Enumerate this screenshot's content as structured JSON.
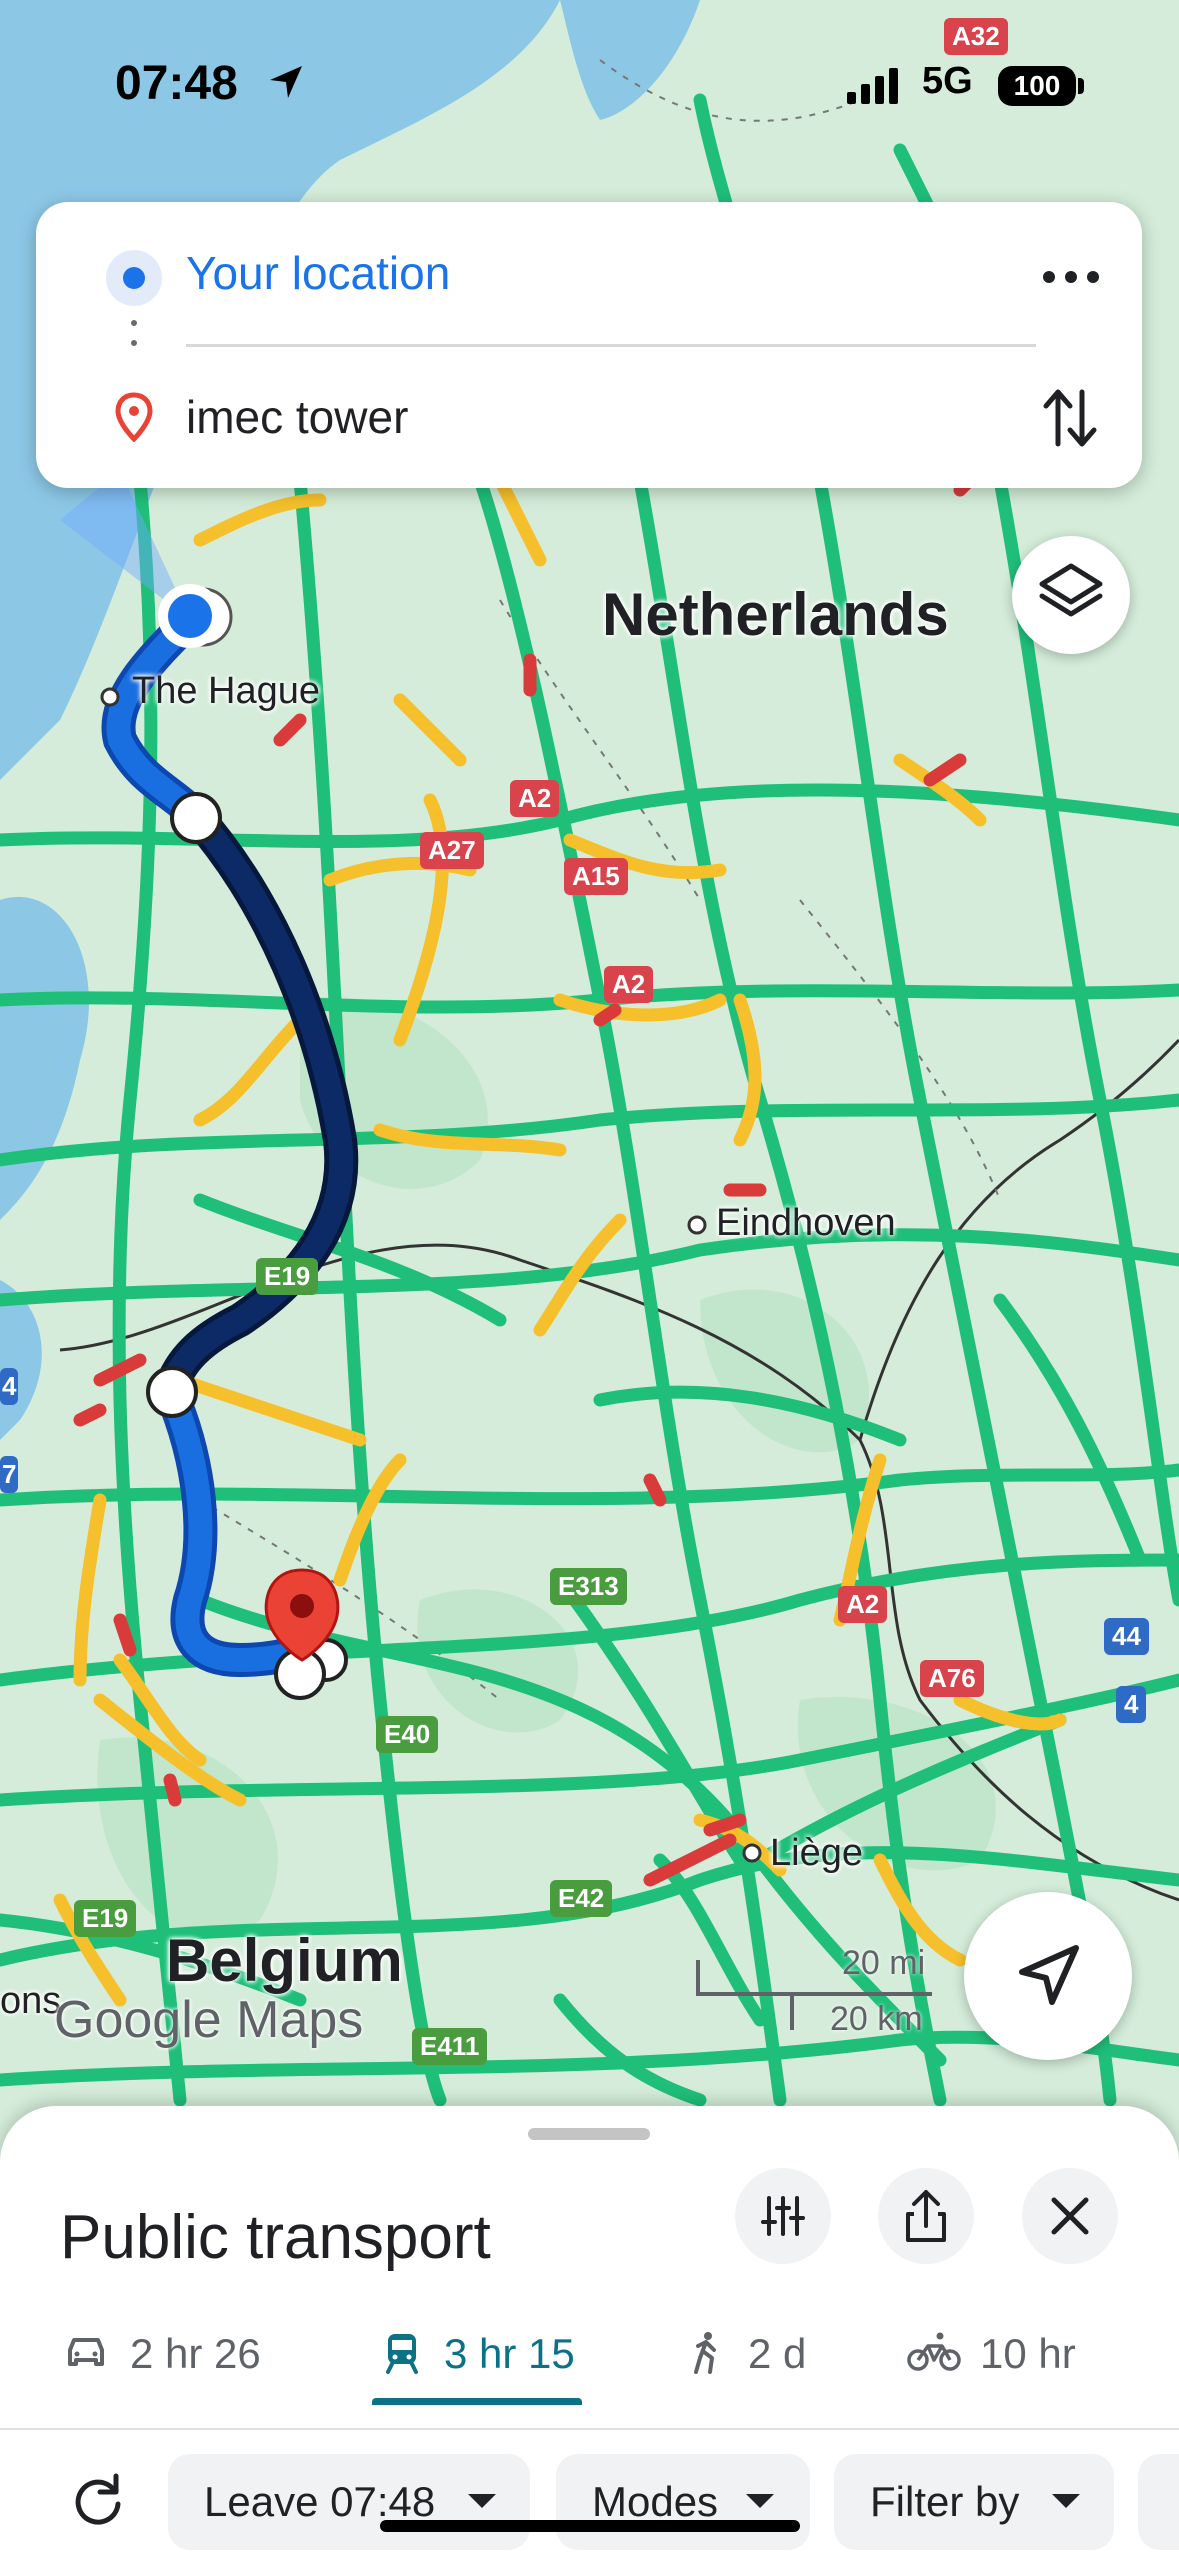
{
  "status_bar": {
    "time": "07:48",
    "network": "5G",
    "battery": "100"
  },
  "search": {
    "origin": "Your location",
    "destination": "imec tower"
  },
  "map_labels": {
    "countries": [
      "Netherlands",
      "Belgium"
    ],
    "cities": [
      "The Hague",
      "Eindhoven",
      "Liège",
      "ons"
    ],
    "road_shields": {
      "red": [
        "A32",
        "A2",
        "A27",
        "A15",
        "A2",
        "A2",
        "A76"
      ],
      "green": [
        "E19",
        "E313",
        "E40",
        "E42",
        "E19",
        "E411"
      ],
      "blue": [
        "44",
        "4"
      ],
      "edge": [
        "4",
        "7"
      ]
    },
    "attribution": "Google Maps",
    "scale_mi": "20 mi",
    "scale_km": "20 km"
  },
  "sheet": {
    "title": "Public transport",
    "modes": [
      {
        "icon": "car-icon",
        "label": "2 hr 26",
        "active": false
      },
      {
        "icon": "train-icon",
        "label": "3 hr 15",
        "active": true
      },
      {
        "icon": "walk-icon",
        "label": "2 d",
        "active": false
      },
      {
        "icon": "bike-icon",
        "label": "10 hr",
        "active": false
      }
    ],
    "filters": {
      "leave": "Leave 07:48",
      "modes": "Modes",
      "filter_by": "Filter by"
    }
  },
  "colors": {
    "road_green": "#1fbf7a",
    "road_yellow": "#f5c02b",
    "road_red": "#d93a3a",
    "route_light": "#1a6fe0",
    "route_dark": "#0c2a66",
    "accent": "#0b7285",
    "water": "#8cc8e6",
    "land": "#d4ecd9"
  }
}
